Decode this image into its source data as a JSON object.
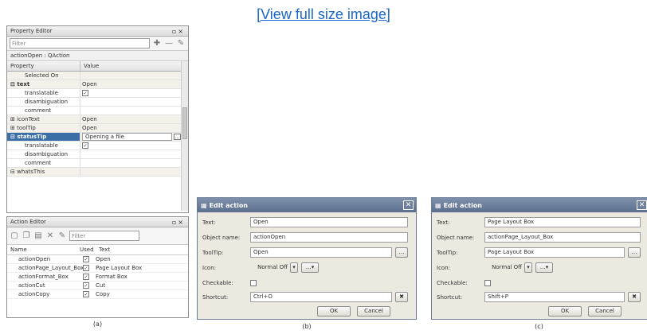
{
  "header": {
    "link_text": "[View full size image]"
  },
  "property_editor": {
    "title": "Property Editor",
    "filter_placeholder": "Filter",
    "object_label": "actionOpen : QAction",
    "col_property": "Property",
    "col_value": "Value",
    "rows": [
      {
        "name": "Selected On",
        "value": ""
      },
      {
        "name": "text",
        "value": "Open"
      },
      {
        "name": "translatable",
        "value": "☑"
      },
      {
        "name": "disambiguation",
        "value": ""
      },
      {
        "name": "comment",
        "value": ""
      },
      {
        "name": "iconText",
        "value": "Open"
      },
      {
        "name": "toolTip",
        "value": "Open"
      },
      {
        "name": "statusTip",
        "value": "Opening a file"
      },
      {
        "name": "translatable",
        "value": "☑"
      },
      {
        "name": "disambiguation",
        "value": ""
      },
      {
        "name": "comment",
        "value": ""
      },
      {
        "name": "whatsThis",
        "value": ""
      }
    ]
  },
  "action_editor": {
    "title": "Action Editor",
    "filter_placeholder": "Filter",
    "col_name": "Name",
    "col_used": "Used",
    "col_text": "Text",
    "rows": [
      {
        "name": "actionOpen",
        "text": "Open"
      },
      {
        "name": "actionPage_Layout_Box",
        "text": "Page Layout Box"
      },
      {
        "name": "actionFormat_Box",
        "text": "Format Box"
      },
      {
        "name": "actionCut",
        "text": "Cut"
      },
      {
        "name": "actionCopy",
        "text": "Copy"
      }
    ]
  },
  "captions": {
    "a": "(a)",
    "b": "(b)",
    "c": "(c)"
  },
  "dialog_b": {
    "title": "Edit action",
    "text_label": "Text:",
    "text_value": "Open",
    "object_label": "Object name:",
    "object_value": "actionOpen",
    "tooltip_label": "ToolTip:",
    "tooltip_value": "Open",
    "icon_label": "Icon:",
    "icon_value": "Normal Off",
    "checkable_label": "Checkable:",
    "shortcut_label": "Shortcut:",
    "shortcut_value": "Ctrl+O",
    "ok": "OK",
    "cancel": "Cancel"
  },
  "dialog_c": {
    "title": "Edit action",
    "text_label": "Text:",
    "text_value": "Page Layout Box",
    "object_label": "Object name:",
    "object_value": "actionPage_Layout_Box",
    "tooltip_label": "ToolTip:",
    "tooltip_value": "Page Layout Box",
    "icon_label": "Icon:",
    "icon_value": "Normal Off",
    "checkable_label": "Checkable:",
    "shortcut_label": "Shortcut:",
    "shortcut_value": "Shift+P",
    "ok": "OK",
    "cancel": "Cancel"
  }
}
